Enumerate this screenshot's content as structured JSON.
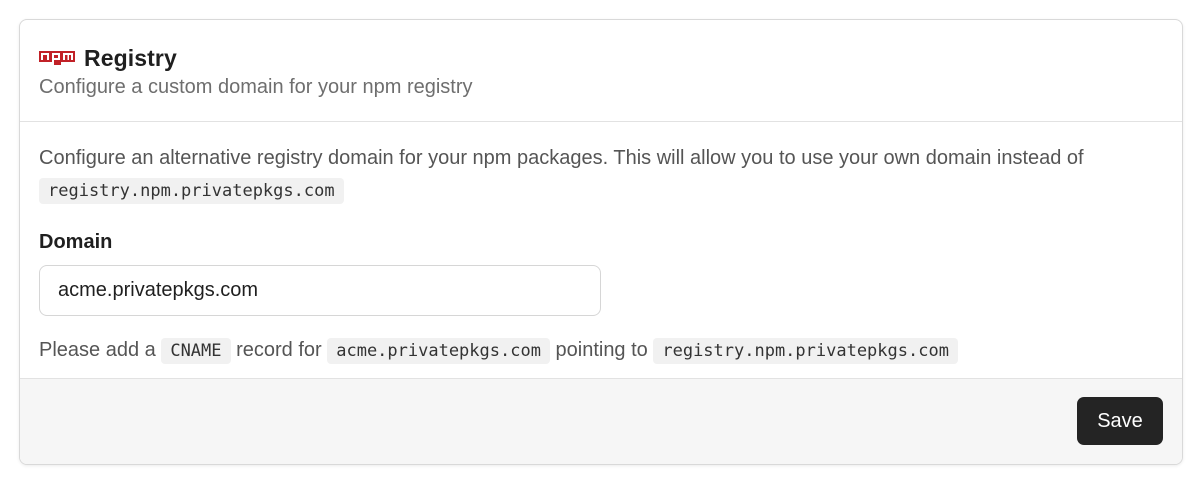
{
  "header": {
    "logo_icon": "npm-logo-icon",
    "logo_color": "#c12127",
    "title": "Registry",
    "subtitle": "Configure a custom domain for your npm registry"
  },
  "body": {
    "intro_text": "Configure an alternative registry domain for your npm packages. This will allow you to use your own domain instead of",
    "intro_code": "registry.npm.privatepkgs.com",
    "domain_label": "Domain",
    "domain_value": "acme.privatepkgs.com",
    "hint": {
      "part1": "Please add a",
      "code1": "CNAME",
      "part2": "record for",
      "code2": "acme.privatepkgs.com",
      "part3": "pointing to",
      "code3": "registry.npm.privatepkgs.com"
    }
  },
  "footer": {
    "save_label": "Save"
  }
}
